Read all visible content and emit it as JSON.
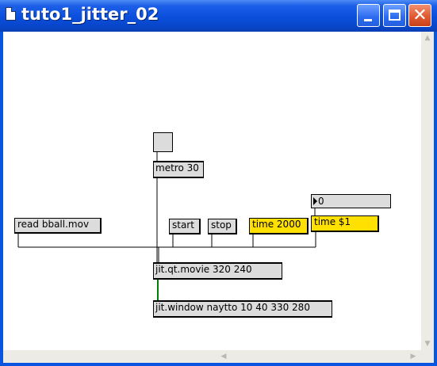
{
  "window": {
    "title": "tuto1_jitter_02",
    "titlebar_color": "#0a4fdc"
  },
  "controls": {
    "minimize_icon": "minimize-icon",
    "maximize_icon": "maximize-icon",
    "close_icon": "close-icon",
    "close_glyph": "✕"
  },
  "patch": {
    "number_value": "0",
    "objects": {
      "metro": "metro 30",
      "movie": "jit.qt.movie 320 240",
      "window": "jit.window naytto 10 40 330 280"
    },
    "messages": {
      "read": "read bball.mov",
      "start": "start",
      "stop": "stop",
      "time2000": "time 2000",
      "time_var": "time $1"
    },
    "colors": {
      "object_bg": "#dcdcdc",
      "message_highlight": "#ffe000",
      "matrix_cord": "#008000"
    }
  },
  "scrollbars": {
    "arrow_up": "▲",
    "arrow_down": "▼",
    "arrow_left": "◀",
    "arrow_right": "▶"
  }
}
